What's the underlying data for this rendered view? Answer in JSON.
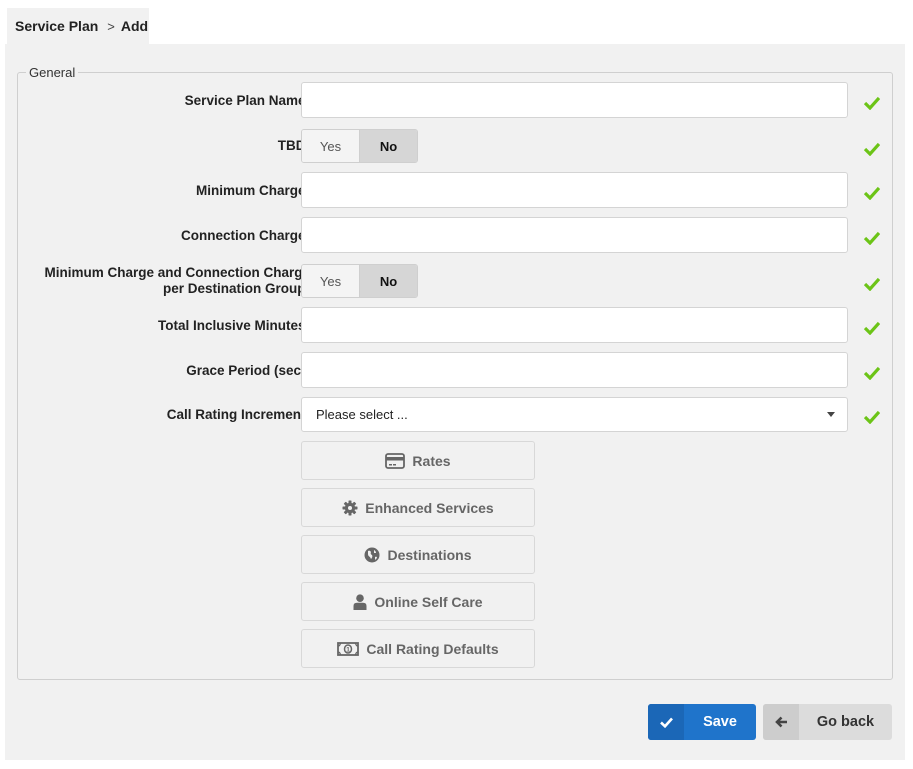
{
  "breadcrumb": {
    "items": [
      "Service Plan",
      "Add"
    ],
    "separator": ">"
  },
  "fieldset": {
    "legend": "General"
  },
  "fields": [
    {
      "label": "Service Plan Name:",
      "type": "text",
      "value": "",
      "valid": true
    },
    {
      "label": "TBD:",
      "type": "toggle",
      "options": [
        "Yes",
        "No"
      ],
      "selected": "No",
      "valid": true
    },
    {
      "label": "Minimum Charge:",
      "type": "text",
      "value": "",
      "valid": true
    },
    {
      "label": "Connection Charge:",
      "type": "text",
      "value": "",
      "valid": true
    },
    {
      "label_line1": "Minimum Charge and Connection Charge",
      "label_line2": "per Destination Group:",
      "type": "toggle",
      "options": [
        "Yes",
        "No"
      ],
      "selected": "No",
      "valid": true
    },
    {
      "label": "Total Inclusive Minutes:",
      "type": "text",
      "value": "",
      "valid": true
    },
    {
      "label": "Grace Period (sec):",
      "type": "text",
      "value": "",
      "valid": true
    },
    {
      "label": "Call Rating Increment:",
      "type": "select",
      "value": "Please select ...",
      "valid": true
    }
  ],
  "sub_buttons": [
    {
      "label": "Rates",
      "icon": "credit-card-icon"
    },
    {
      "label": "Enhanced Services",
      "icon": "gear-icon"
    },
    {
      "label": "Destinations",
      "icon": "globe-icon"
    },
    {
      "label": "Online Self Care",
      "icon": "user-icon"
    },
    {
      "label": "Call Rating Defaults",
      "icon": "money-icon"
    }
  ],
  "actions": {
    "save_label": "Save",
    "back_label": "Go back"
  },
  "colors": {
    "valid_check": "#6cc417",
    "primary": "#1f74cb",
    "panel_bg": "#f1f1f1"
  }
}
